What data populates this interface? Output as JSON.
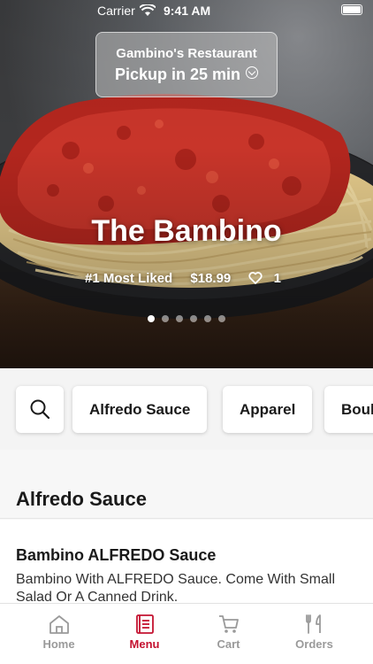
{
  "status_bar": {
    "carrier": "Carrier",
    "time": "9:41 AM"
  },
  "header": {
    "restaurant_name": "Gambino's Restaurant",
    "pickup_text": "Pickup in 25 min"
  },
  "hero": {
    "title": "The Bambino",
    "rank": "#1 Most Liked",
    "price": "$18.99",
    "likes": "1",
    "carousel_pages": 6,
    "carousel_active": 0
  },
  "categories": {
    "items": [
      "Alfredo Sauce",
      "Apparel",
      "Boul"
    ]
  },
  "section": {
    "title": "Alfredo Sauce"
  },
  "menu_item": {
    "title": "Bambino ALFREDO Sauce",
    "description": "Bambino With ALFREDO Sauce. Come With Small Salad Or A Canned Drink."
  },
  "tabbar": {
    "tabs": [
      {
        "label": "Home",
        "icon": "home-icon",
        "active": false
      },
      {
        "label": "Menu",
        "icon": "menu-icon",
        "active": true
      },
      {
        "label": "Cart",
        "icon": "cart-icon",
        "active": false
      },
      {
        "label": "Orders",
        "icon": "orders-icon",
        "active": false
      }
    ]
  },
  "colors": {
    "accent": "#c41230",
    "inactive": "#9a9a9a"
  }
}
